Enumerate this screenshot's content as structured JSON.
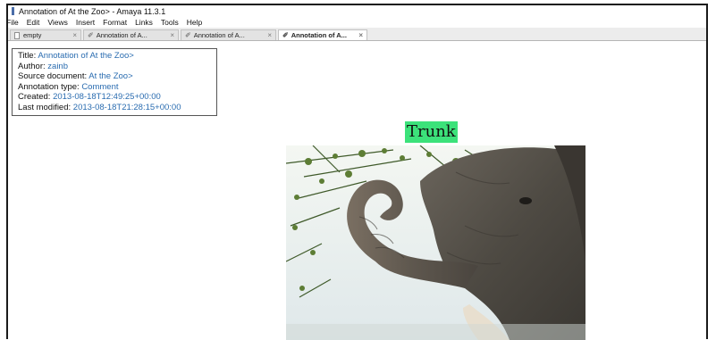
{
  "window": {
    "title": "Annotation of At the Zoo> - Amaya 11.3.1"
  },
  "menubar": {
    "items": [
      {
        "label": "File"
      },
      {
        "label": "Edit"
      },
      {
        "label": "Views"
      },
      {
        "label": "Insert"
      },
      {
        "label": "Format"
      },
      {
        "label": "Links"
      },
      {
        "label": "Tools"
      },
      {
        "label": "Help"
      }
    ]
  },
  "tabs": [
    {
      "label": "empty",
      "icon": "doc-icon",
      "close": "×",
      "active": false
    },
    {
      "label": "Annotation of A...",
      "icon": "edit-icon",
      "close": "×",
      "active": false
    },
    {
      "label": "Annotation of A...",
      "icon": "edit-icon",
      "close": "×",
      "active": false
    },
    {
      "label": "Annotation of A...",
      "icon": "edit-icon",
      "close": "×",
      "active": true
    }
  ],
  "annotation": {
    "title_label": "Title:",
    "title_value": "Annotation of At the Zoo>",
    "author_label": "Author:",
    "author_value": "zainb",
    "source_label": "Source document:",
    "source_value": "At the Zoo>",
    "type_label": "Annotation type:",
    "type_value": "Comment",
    "created_label": "Created:",
    "created_value": "2013-08-18T12:49:25+00:00",
    "modified_label": "Last modified:",
    "modified_value": "2013-08-18T21:28:15+00:00"
  },
  "content": {
    "heading": "Trunk",
    "heading_highlight_color": "#3ce27a",
    "image": "elephant-trunk-photo"
  },
  "colors": {
    "link": "#2a6cb0",
    "window_border": "#1a1a1a"
  }
}
